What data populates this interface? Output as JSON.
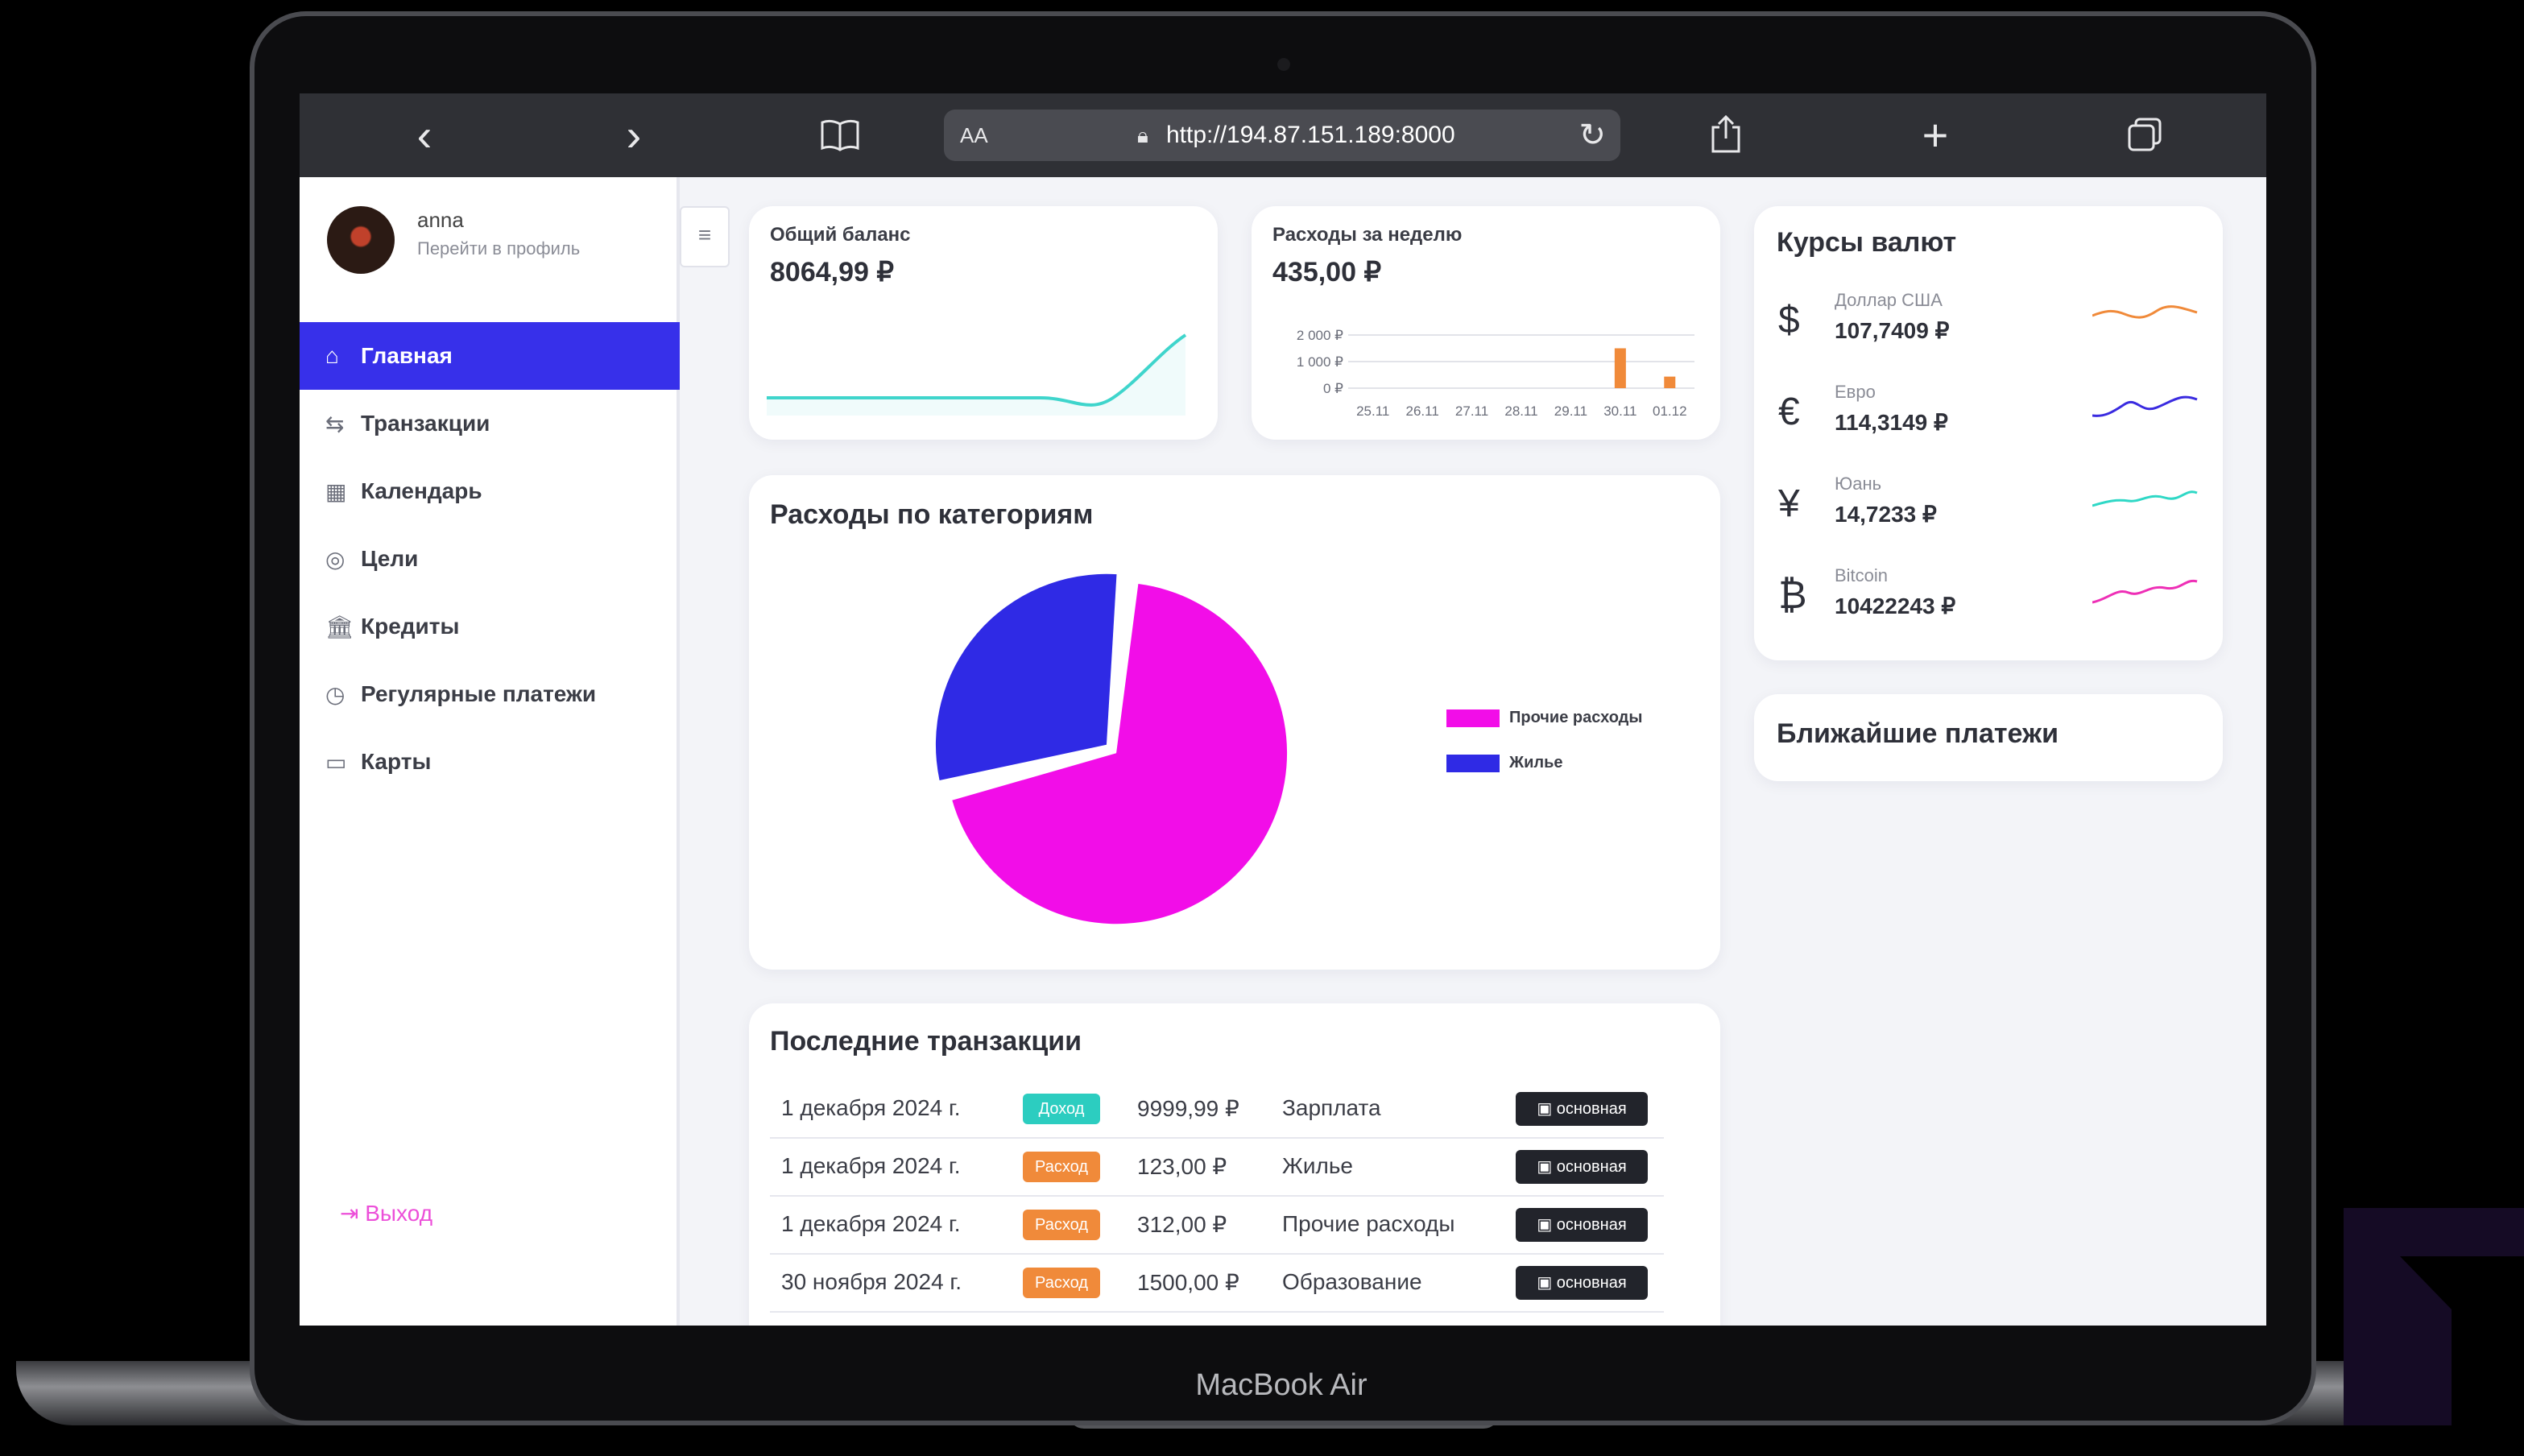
{
  "device": {
    "label": "MacBook Air"
  },
  "browser": {
    "aa_label": "AA",
    "url": "http://194.87.151.189:8000",
    "icons": [
      "back-icon",
      "forward-icon",
      "bookmarks-icon",
      "lock-icon",
      "reload-icon",
      "share-icon",
      "new-tab-icon",
      "tabs-icon"
    ]
  },
  "profile": {
    "name": "anna",
    "link": "Перейти в профиль"
  },
  "sidebar": {
    "items": [
      {
        "label": "Главная",
        "icon": "home-icon",
        "active": true
      },
      {
        "label": "Транзакции",
        "icon": "transfer-icon"
      },
      {
        "label": "Календарь",
        "icon": "calendar-icon"
      },
      {
        "label": "Цели",
        "icon": "target-icon"
      },
      {
        "label": "Кредиты",
        "icon": "bank-icon"
      },
      {
        "label": "Регулярные платежи",
        "icon": "clock-icon"
      },
      {
        "label": "Карты",
        "icon": "card-icon"
      }
    ],
    "logout": "Выход"
  },
  "balance": {
    "label": "Общий баланс",
    "value": "8064,99 ₽"
  },
  "weekly": {
    "label": "Расходы за неделю",
    "value": "435,00 ₽",
    "chart_data": {
      "type": "bar",
      "categories": [
        "25.11",
        "26.11",
        "27.11",
        "28.11",
        "29.11",
        "30.11",
        "01.12"
      ],
      "values": [
        0,
        0,
        0,
        0,
        0,
        1500,
        435
      ],
      "y_ticks": [
        "2 000 ₽",
        "1 000 ₽",
        "0 ₽"
      ],
      "ylim": [
        0,
        2000
      ],
      "color": "#f08a3a"
    }
  },
  "categories_chart": {
    "title": "Расходы по категориям",
    "chart_data": {
      "type": "pie",
      "labels": [
        "Прочие расходы",
        "Жилье"
      ],
      "values": [
        69.6,
        30.4
      ],
      "colors": [
        "#f20de8",
        "#2f2ae5"
      ]
    }
  },
  "currency": {
    "title": "Курсы валют",
    "items": [
      {
        "symbol": "$",
        "name": "Доллар США",
        "value": "107,7409 ₽",
        "color": "#f08a3a"
      },
      {
        "symbol": "€",
        "name": "Евро",
        "value": "114,3149 ₽",
        "color": "#3a2be0"
      },
      {
        "symbol": "¥",
        "name": "Юань",
        "value": "14,7233 ₽",
        "color": "#2fd8c6"
      },
      {
        "symbol": "₿",
        "name": "Bitcoin",
        "value": "10422243 ₽",
        "color": "#ee2fb6"
      }
    ]
  },
  "upcoming": {
    "title": "Ближайшие платежи"
  },
  "transactions": {
    "title": "Последние транзакции",
    "rows": [
      {
        "date": "1 декабря 2024 г.",
        "type": "Доход",
        "type_color": "#2ccdc0",
        "amount": "9999,99 ₽",
        "category": "Зарплата",
        "card": "основная"
      },
      {
        "date": "1 декабря 2024 г.",
        "type": "Расход",
        "type_color": "#f08a3a",
        "amount": "123,00 ₽",
        "category": "Жилье",
        "card": "основная"
      },
      {
        "date": "1 декабря 2024 г.",
        "type": "Расход",
        "type_color": "#f08a3a",
        "amount": "312,00 ₽",
        "category": "Прочие расходы",
        "card": "основная"
      },
      {
        "date": "30 ноября 2024 г.",
        "type": "Расход",
        "type_color": "#f08a3a",
        "amount": "1500,00 ₽",
        "category": "Образование",
        "card": "основная"
      }
    ]
  }
}
